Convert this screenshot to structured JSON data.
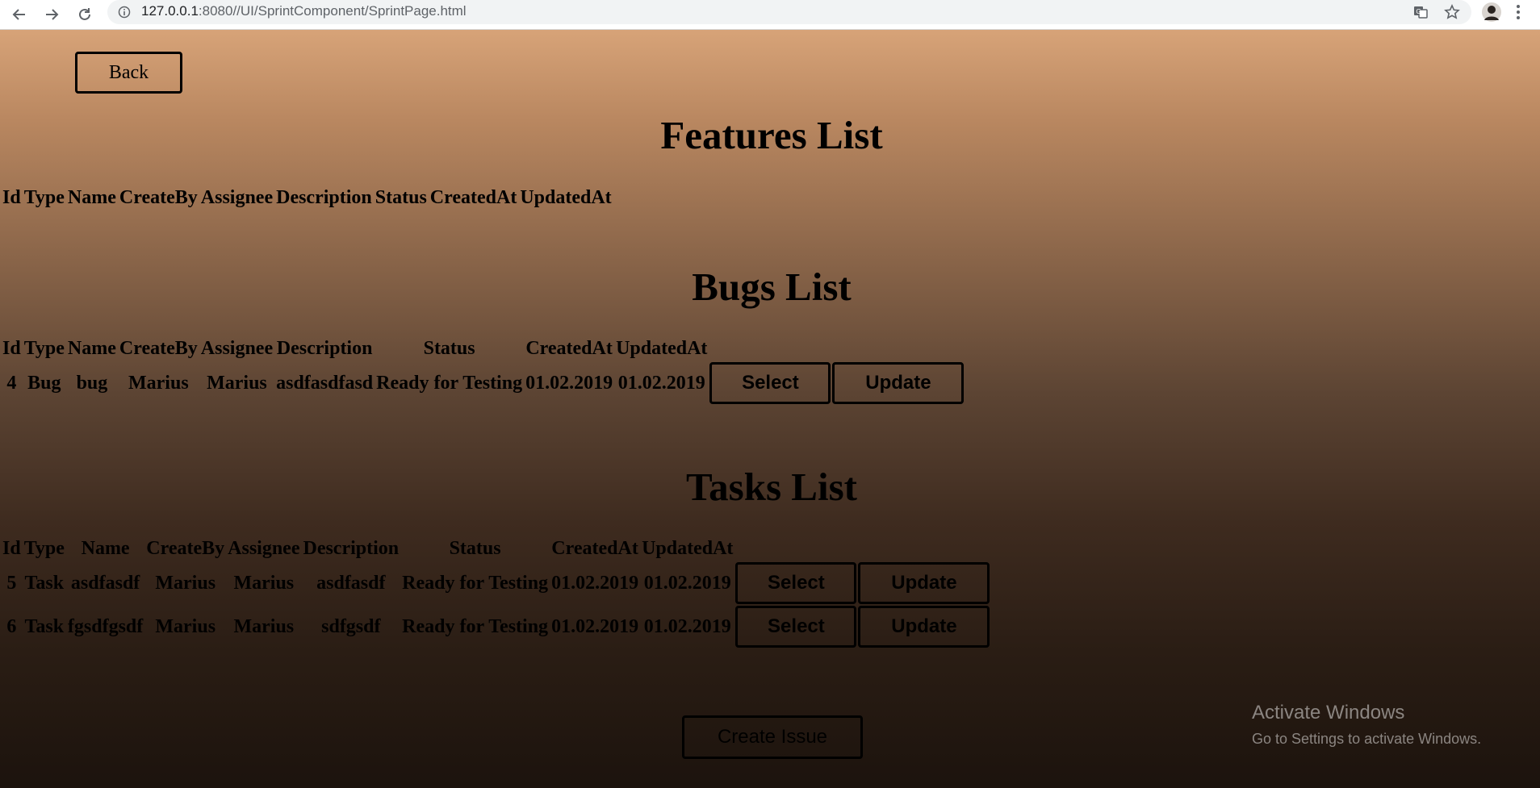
{
  "browser": {
    "url_host": "127.0.0.1",
    "url_rest": ":8080//UI/SprintComponent/SprintPage.html",
    "icons": [
      "back-arrow-icon",
      "forward-arrow-icon",
      "reload-icon",
      "info-icon",
      "translate-icon",
      "star-icon",
      "profile-avatar",
      "menu-dots-icon"
    ]
  },
  "page": {
    "back_label": "Back",
    "create_issue_label": "Create Issue",
    "headers": [
      "Id",
      "Type",
      "Name",
      "CreateBy",
      "Assignee",
      "Description",
      "Status",
      "CreatedAt",
      "UpdatedAt"
    ],
    "features": {
      "title": "Features List",
      "rows": []
    },
    "bugs": {
      "title": "Bugs List",
      "rows": [
        {
          "id": "4",
          "type": "Bug",
          "name": "bug",
          "created_by": "Marius",
          "assignee": "Marius",
          "description": "asdfasdfasd",
          "status": "Ready for Testing",
          "created_at": "01.02.2019",
          "updated_at": "01.02.2019",
          "select_label": "Select",
          "update_label": "Update"
        }
      ]
    },
    "tasks": {
      "title": "Tasks List",
      "rows": [
        {
          "id": "5",
          "type": "Task",
          "name": "asdfasdf",
          "created_by": "Marius",
          "assignee": "Marius",
          "description": "asdfasdf",
          "status": "Ready for Testing",
          "created_at": "01.02.2019",
          "updated_at": "01.02.2019",
          "select_label": "Select",
          "update_label": "Update"
        },
        {
          "id": "6",
          "type": "Task",
          "name": "fgsdfgsdf",
          "created_by": "Marius",
          "assignee": "Marius",
          "description": "sdfgsdf",
          "status": "Ready for Testing",
          "created_at": "01.02.2019",
          "updated_at": "01.02.2019",
          "select_label": "Select",
          "update_label": "Update"
        }
      ]
    }
  },
  "watermark": {
    "title": "Activate Windows",
    "subtitle": "Go to Settings to activate Windows."
  }
}
